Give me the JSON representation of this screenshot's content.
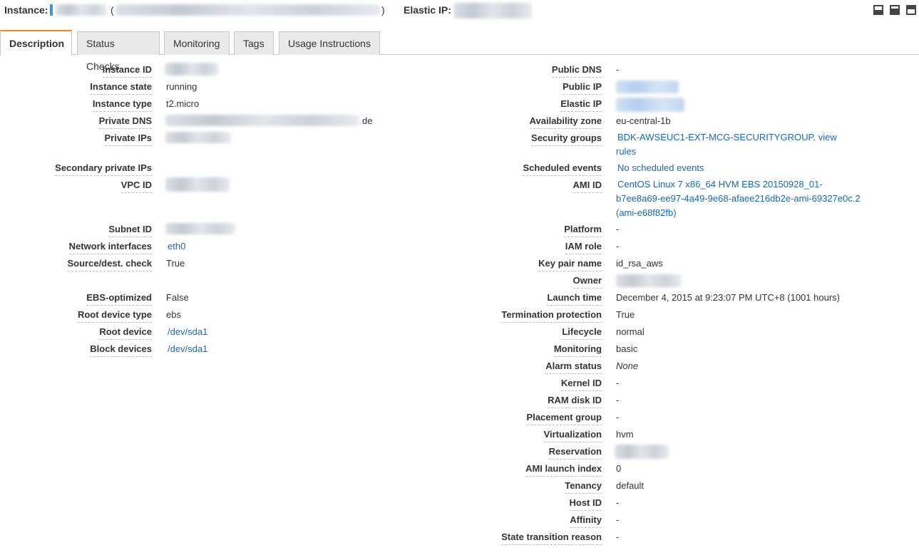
{
  "header": {
    "instance_label": "Instance:",
    "paren_open": "(",
    "paren_close": ")",
    "elastic_ip_label": "Elastic IP:",
    "layout_icons": [
      "layout-bottom-icon",
      "layout-split-icon",
      "layout-top-icon"
    ]
  },
  "tabs": [
    {
      "label": "Description",
      "active": true
    },
    {
      "label": "Status Checks",
      "active": false
    },
    {
      "label": "Monitoring",
      "active": false
    },
    {
      "label": "Tags",
      "active": false
    },
    {
      "label": "Usage Instructions",
      "active": false
    }
  ],
  "left": {
    "instance_id": {
      "label": "Instance ID",
      "value": ""
    },
    "instance_state": {
      "label": "Instance state",
      "value": "running"
    },
    "instance_type": {
      "label": "Instance type",
      "value": "t2.micro"
    },
    "private_dns": {
      "label": "Private DNS",
      "value_suffix": "de"
    },
    "private_ips": {
      "label": "Private IPs",
      "value": ""
    },
    "secondary_private_ips": {
      "label": "Secondary private IPs",
      "value": ""
    },
    "vpc_id": {
      "label": "VPC ID",
      "value": ""
    },
    "subnet_id": {
      "label": "Subnet ID",
      "value": ""
    },
    "network_interfaces": {
      "label": "Network interfaces",
      "value": "eth0"
    },
    "source_dest_check": {
      "label": "Source/dest. check",
      "value": "True"
    },
    "ebs_optimized": {
      "label": "EBS-optimized",
      "value": "False"
    },
    "root_device_type": {
      "label": "Root device type",
      "value": "ebs"
    },
    "root_device": {
      "label": "Root device",
      "value": "/dev/sda1"
    },
    "block_devices": {
      "label": "Block devices",
      "value": "/dev/sda1"
    }
  },
  "right": {
    "public_dns": {
      "label": "Public DNS",
      "value": "-"
    },
    "public_ip": {
      "label": "Public IP",
      "value": ""
    },
    "elastic_ip": {
      "label": "Elastic IP",
      "value": ""
    },
    "availability_zone": {
      "label": "Availability zone",
      "value": "eu-central-1b"
    },
    "security_groups": {
      "label": "Security groups",
      "value": "BDK-AWSEUC1-EXT-MCG-SECURITYGROUP",
      "sep": ". ",
      "view_rules": "view rules"
    },
    "scheduled_events": {
      "label": "Scheduled events",
      "value": "No scheduled events"
    },
    "ami_id": {
      "label": "AMI ID",
      "line1": "CentOS Linux 7 x86_64 HVM EBS 20150928_01-",
      "line2": "b7ee8a69-ee97-4a49-9e68-afaee216db2e-ami-69327e0c.2",
      "line3": "(ami-e68f82fb)"
    },
    "platform": {
      "label": "Platform",
      "value": "-"
    },
    "iam_role": {
      "label": "IAM role",
      "value": "-"
    },
    "key_pair_name": {
      "label": "Key pair name",
      "value": "id_rsa_aws"
    },
    "owner": {
      "label": "Owner",
      "value": ""
    },
    "launch_time": {
      "label": "Launch time",
      "value": "December 4, 2015 at 9:23:07 PM UTC+8 (1001 hours)"
    },
    "termination_protection": {
      "label": "Termination protection",
      "value": "True"
    },
    "lifecycle": {
      "label": "Lifecycle",
      "value": "normal"
    },
    "monitoring": {
      "label": "Monitoring",
      "value": "basic"
    },
    "alarm_status": {
      "label": "Alarm status",
      "value": "None"
    },
    "kernel_id": {
      "label": "Kernel ID",
      "value": "-"
    },
    "ram_disk_id": {
      "label": "RAM disk ID",
      "value": "-"
    },
    "placement_group": {
      "label": "Placement group",
      "value": "-"
    },
    "virtualization": {
      "label": "Virtualization",
      "value": "hvm"
    },
    "reservation": {
      "label": "Reservation",
      "value": ""
    },
    "ami_launch_index": {
      "label": "AMI launch index",
      "value": "0"
    },
    "tenancy": {
      "label": "Tenancy",
      "value": "default"
    },
    "host_id": {
      "label": "Host ID",
      "value": "-"
    },
    "affinity": {
      "label": "Affinity",
      "value": "-"
    },
    "state_transition_reason": {
      "label": "State transition reason",
      "value": "-"
    }
  },
  "colors": {
    "accent_tab": "#e98a1e",
    "link": "#1a66b5",
    "marker": "#4a90d9"
  }
}
